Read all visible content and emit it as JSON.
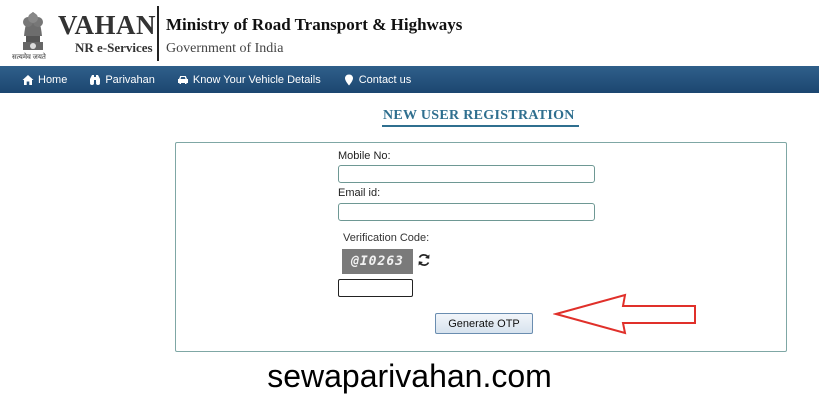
{
  "header": {
    "brand_title": "VAHAN",
    "brand_subtitle": "NR e-Services",
    "emblem_motto": "सत्यमेव जयते",
    "ministry": "Ministry of Road Transport & Highways",
    "government": "Government of India"
  },
  "nav": {
    "items": [
      {
        "label": "Home",
        "icon": "home-icon"
      },
      {
        "label": "Parivahan",
        "icon": "binoculars-icon"
      },
      {
        "label": "Know Your Vehicle Details",
        "icon": "car-icon"
      },
      {
        "label": "Contact us",
        "icon": "map-marker-icon"
      }
    ]
  },
  "page": {
    "title": "NEW USER REGISTRATION"
  },
  "form": {
    "mobile_label": "Mobile No:",
    "mobile_value": "",
    "email_label": "Email id:",
    "email_value": "",
    "verification_label": "Verification Code:",
    "captcha_text": "@I0263",
    "captcha_input_value": "",
    "generate_otp_label": "Generate OTP"
  },
  "annotation": {
    "arrow_color": "#e0302a"
  },
  "watermark": "sewaparivahan.com"
}
